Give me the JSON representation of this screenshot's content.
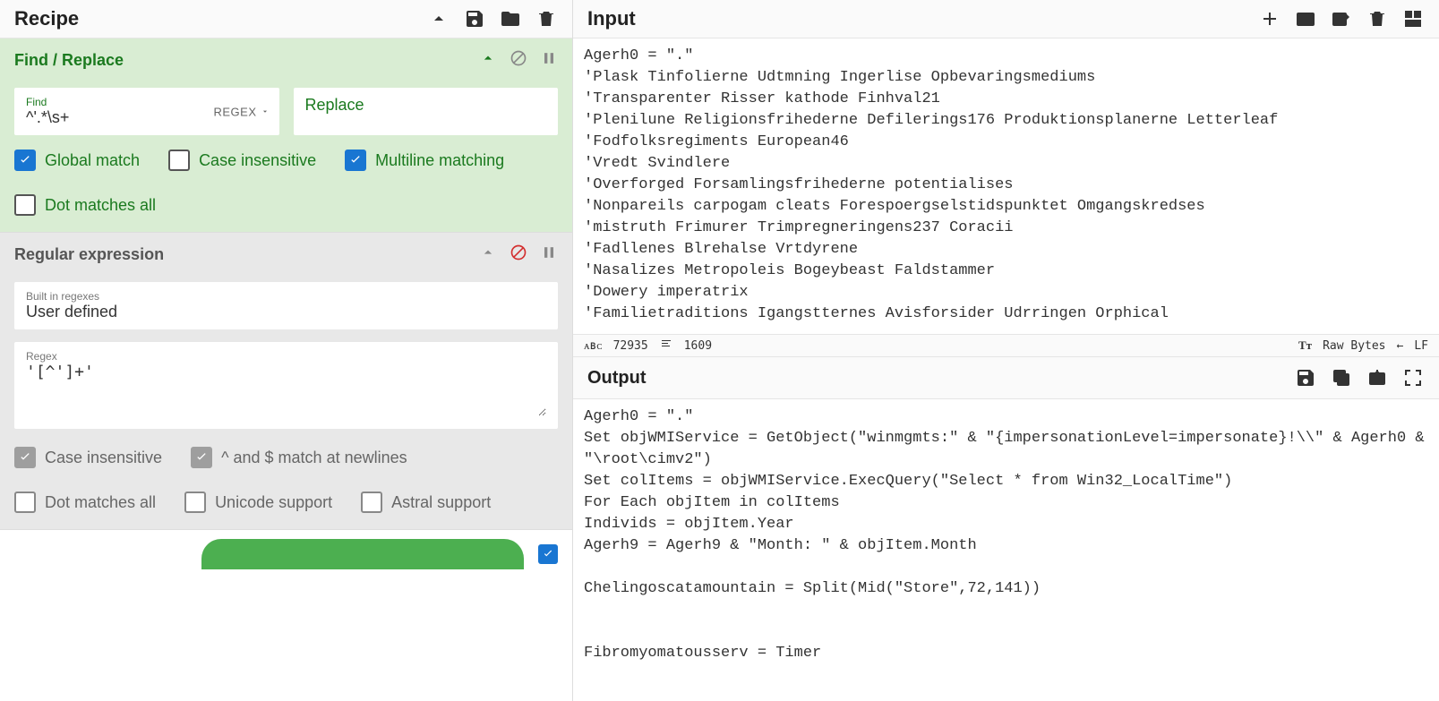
{
  "recipe": {
    "title": "Recipe"
  },
  "op1": {
    "title": "Find / Replace",
    "find_label": "Find",
    "find_value": "^'.*\\s+",
    "regex_chip": "REGEX",
    "replace_label": "Replace",
    "checks": {
      "global": "Global match",
      "case": "Case insensitive",
      "multi": "Multiline matching",
      "dot": "Dot matches all"
    }
  },
  "op2": {
    "title": "Regular expression",
    "builtin_label": "Built in regexes",
    "builtin_value": "User defined",
    "regex_label": "Regex",
    "regex_value": "'[^']+'",
    "checks": {
      "case": "Case insensitive",
      "caret": "^ and $ match at newlines",
      "dot": "Dot matches all",
      "unicode": "Unicode support",
      "astral": "Astral support"
    }
  },
  "input": {
    "title": "Input",
    "text": "Agerh0 = \".\"\n'Plask Tinfolierne Udtmning Ingerlise Opbevaringsmediums\n'Transparenter Risser kathode Finhval21\n'Plenilune Religionsfrihederne Defilerings176 Produktionsplanerne Letterleaf\n'Fodfolksregiments European46\n'Vredt Svindlere\n'Overforged Forsamlingsfrihederne potentialises\n'Nonpareils carpogam cleats Forespoergselstidspunktet Omgangskredses\n'mistruth Frimurer Trimpregneringens237 Coracii\n'Fadllenes Blrehalse Vrtdyrene\n'Nasalizes Metropoleis Bogeybeast Faldstammer\n'Dowery imperatrix\n'Familietraditions Igangstternes Avisforsider Udrringen Orphical"
  },
  "status": {
    "abc": "ᴀʙᴄ",
    "chars": "72935",
    "lines": "1609",
    "rawbytes": "Raw Bytes",
    "lf": "LF"
  },
  "output": {
    "title": "Output",
    "text": "Agerh0 = \".\"\nSet objWMIService = GetObject(\"winmgmts:\" & \"{impersonationLevel=impersonate}!\\\\\" & Agerh0 & \"\\root\\cimv2\")\nSet colItems = objWMIService.ExecQuery(\"Select * from Win32_LocalTime\")\nFor Each objItem in colItems\nIndivids = objItem.Year\nAgerh9 = Agerh9 & \"Month: \" & objItem.Month\n\nChelingoscatamountain = Split(Mid(\"Store\",72,141))\n\n\nFibromyomatousserv = Timer"
  }
}
